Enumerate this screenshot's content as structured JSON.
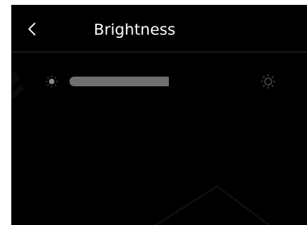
{
  "header": {
    "back_icon": "chevron-left-icon",
    "title": "Brightness"
  },
  "brightness": {
    "low_icon": "sun-small-icon",
    "high_icon": "sun-large-icon",
    "level": 0.52
  },
  "colors": {
    "background": "#000000",
    "text": "#ffffff",
    "slider_fill": "#6f6f6f",
    "icon": "#5a5a5a"
  }
}
